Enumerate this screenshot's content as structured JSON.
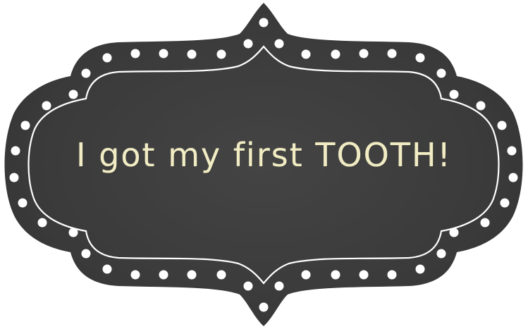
{
  "sign": {
    "caption": "I got my first TOOTH!"
  },
  "colors": {
    "board": "#3d3d3d",
    "board_dark": "#2e2e2e",
    "frame_line": "#ffffff",
    "dots": "#ffffff",
    "chalk_text": "#f1ecc4",
    "background": "#ffffff"
  }
}
